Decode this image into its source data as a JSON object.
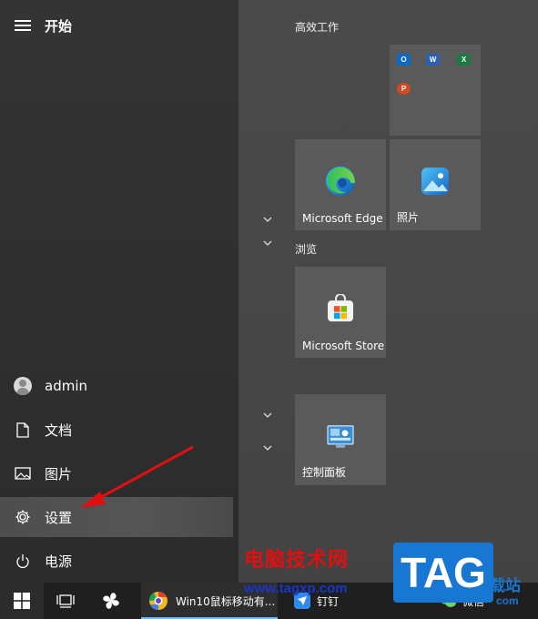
{
  "header": {
    "title": "开始"
  },
  "left_menu": {
    "user": "admin",
    "documents": "文档",
    "pictures": "图片",
    "settings": "设置",
    "power": "电源"
  },
  "groups": {
    "productivity": "高效工作",
    "browse": "浏览"
  },
  "tiles": {
    "edge": "Microsoft Edge",
    "photos": "照片",
    "store": "Microsoft Store",
    "control_panel": "控制面板"
  },
  "office_icons": [
    "outlook-icon",
    "word-icon",
    "excel-icon",
    "powerpoint-icon"
  ],
  "taskbar": {
    "app_label": "Win10鼠标移动有...",
    "partial_label_1": "钉钉",
    "partial_label_2": "微信"
  },
  "watermark": {
    "site_name": "电脑技术网",
    "url": "www.tagxp.com",
    "logo": "TAG",
    "tail": "载站",
    "tail2": "com"
  },
  "colors": {
    "accent": "#76b9ed",
    "arrow": "#e01010",
    "tag_blue": "#1877d2"
  }
}
